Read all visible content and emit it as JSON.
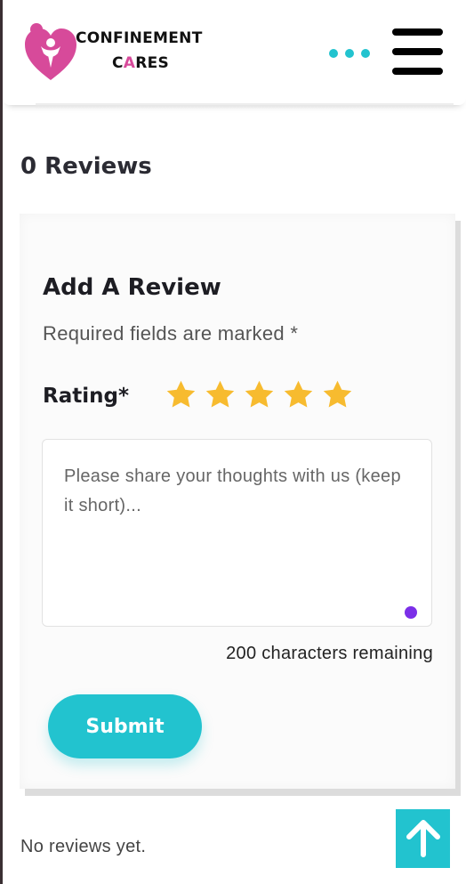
{
  "header": {
    "brand_line1": "CONFINEMENT",
    "brand_line2_a": "C",
    "brand_line2_b": "A",
    "brand_line2_c": "RES",
    "logo_icon": "heart-people-logo-icon",
    "more_icon": "more-dots-icon",
    "menu_icon": "hamburger-menu-icon"
  },
  "reviews": {
    "count_heading": "0 Reviews",
    "empty_text": "No reviews yet."
  },
  "form": {
    "title": "Add A Review",
    "required_note": "Required fields are marked *",
    "rating_label": "Rating*",
    "stars_total": 5,
    "textarea_value": "",
    "textarea_placeholder": "Please share your thoughts with us (keep it short)...",
    "chars_remaining": "200 characters remaining",
    "submit_label": "Submit"
  },
  "colors": {
    "accent": "#22c3cf",
    "brand_pink": "#d74a9a",
    "star": "#f7bb2f"
  },
  "scroll_top_icon": "arrow-up-icon"
}
